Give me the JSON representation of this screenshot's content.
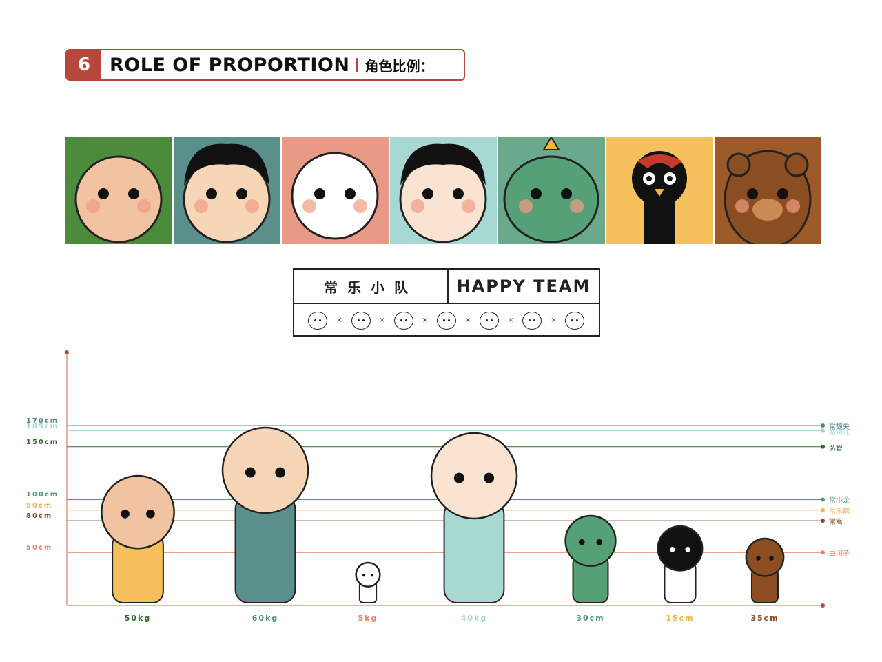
{
  "header": {
    "number": "6",
    "title": "ROLE OF PROPORTION",
    "cn_title": "角色比例：",
    "accent": "#b5483a"
  },
  "tiles": [
    {
      "name": "monk",
      "bg": "#4c8a3c"
    },
    {
      "name": "boy",
      "bg": "#5a8f8c"
    },
    {
      "name": "ghost",
      "bg": "#e99a86"
    },
    {
      "name": "lady",
      "bg": "#a8d8d2"
    },
    {
      "name": "dragon",
      "bg": "#6aa98b"
    },
    {
      "name": "crane",
      "bg": "#f6c05c"
    },
    {
      "name": "bear",
      "bg": "#9b5a28"
    }
  ],
  "team": {
    "cn": "常乐小队",
    "en": "HAPPY TEAM",
    "sep": "×"
  },
  "chart_data": {
    "type": "bar",
    "heights": [
      {
        "label": "170cm",
        "value": 170,
        "name": "常魏央",
        "color": "#4a8a84"
      },
      {
        "label": "165cm",
        "value": 165,
        "name": "赵婉儿",
        "color": "#9fd3cf"
      },
      {
        "label": "150cm",
        "value": 150,
        "name": "弘智",
        "color": "#2f6b2a"
      },
      {
        "label": "100cm",
        "value": 100,
        "name": "常小龙",
        "color": "#4c9a74"
      },
      {
        "label": "90cm",
        "value": 90,
        "name": "常乐鹤",
        "color": "#f2b244"
      },
      {
        "label": "80cm",
        "value": 80,
        "name": "常篱",
        "color": "#8a4a22"
      },
      {
        "label": "50cm",
        "value": 50,
        "name": "白团子",
        "color": "#e8806a"
      }
    ],
    "characters": [
      {
        "weight": "50kg",
        "color": "#2f6b2a"
      },
      {
        "weight": "60kg",
        "color": "#4a8a84"
      },
      {
        "weight": "5kg",
        "color": "#e8806a"
      },
      {
        "weight": "40kg",
        "color": "#9fd3cf"
      },
      {
        "weight": "30cm",
        "color": "#4c9a74"
      },
      {
        "weight": "15cm",
        "color": "#f2b244"
      },
      {
        "weight": "35cm",
        "color": "#8a4a22"
      }
    ],
    "axis_color": "#d9826f"
  }
}
